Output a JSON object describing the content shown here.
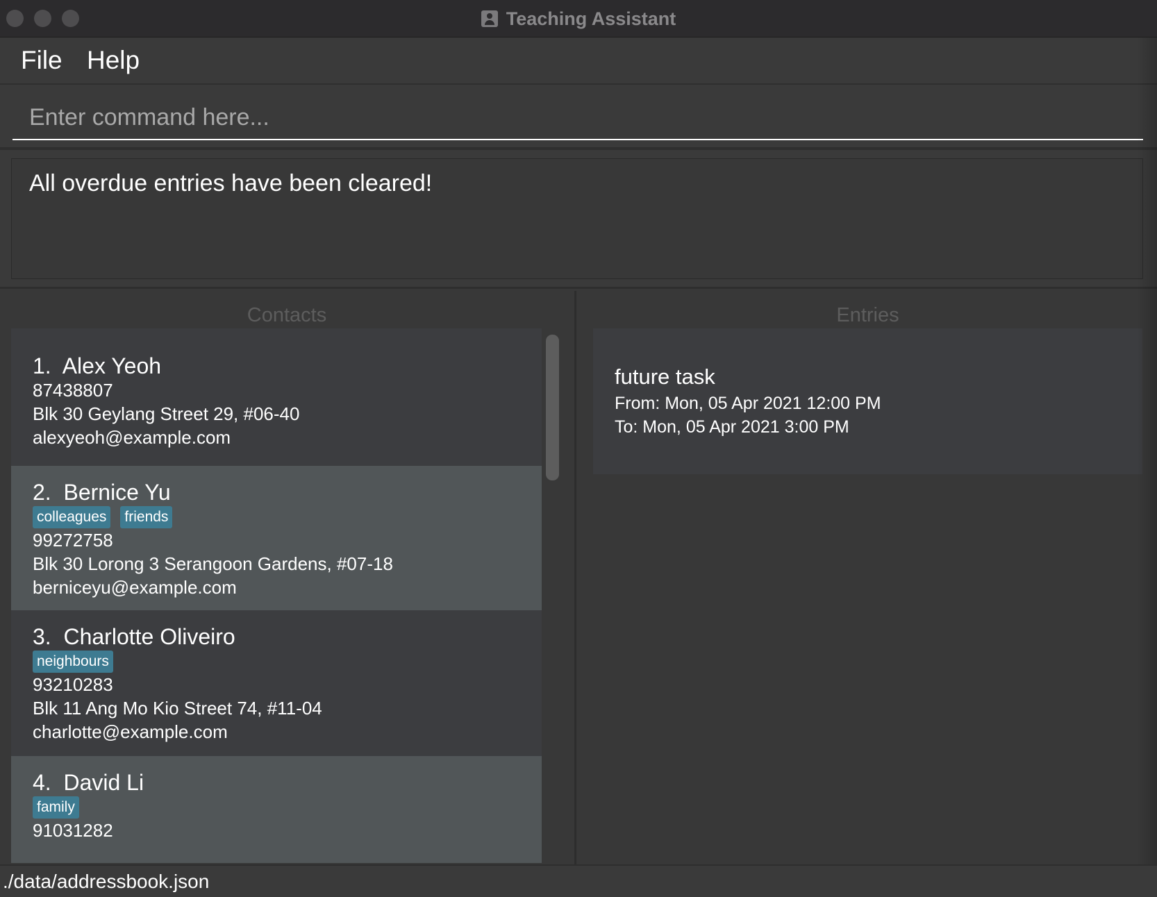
{
  "window": {
    "title": "Teaching Assistant",
    "app_icon": "contact-book-icon"
  },
  "menu": {
    "file": "File",
    "help": "Help"
  },
  "command": {
    "placeholder": "Enter command here...",
    "value": ""
  },
  "result": {
    "message": "All overdue entries have been cleared!"
  },
  "contacts": {
    "heading": "Contacts",
    "items": [
      {
        "index": "1.",
        "name": "Alex Yeoh",
        "tags": [],
        "phone": "87438807",
        "address": "Blk 30 Geylang Street 29, #06-40",
        "email": "alexyeoh@example.com"
      },
      {
        "index": "2.",
        "name": "Bernice Yu",
        "tags": [
          "colleagues",
          "friends"
        ],
        "phone": "99272758",
        "address": "Blk 30 Lorong 3 Serangoon Gardens, #07-18",
        "email": "berniceyu@example.com"
      },
      {
        "index": "3.",
        "name": "Charlotte Oliveiro",
        "tags": [
          "neighbours"
        ],
        "phone": "93210283",
        "address": "Blk 11 Ang Mo Kio Street 74, #11-04",
        "email": "charlotte@example.com"
      },
      {
        "index": "4.",
        "name": "David Li",
        "tags": [
          "family"
        ],
        "phone": "91031282",
        "address": "",
        "email": ""
      }
    ]
  },
  "entries": {
    "heading": "Entries",
    "items": [
      {
        "title": "future task",
        "from": "From: Mon, 05 Apr 2021 12:00 PM",
        "to": "To: Mon, 05 Apr 2021 3:00 PM"
      }
    ]
  },
  "status": {
    "file_path": "./data/addressbook.json"
  },
  "colors": {
    "tag": "#3e7b91",
    "card_odd": "#3c3d40",
    "card_even": "#515658",
    "background": "#383838"
  }
}
